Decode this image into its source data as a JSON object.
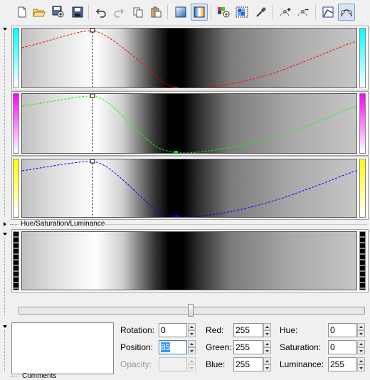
{
  "toolbar": {
    "buttons": [
      {
        "name": "new-icon"
      },
      {
        "name": "open-folder-icon"
      },
      {
        "name": "save-as-icon"
      },
      {
        "name": "save-icon"
      },
      {
        "name": "undo-icon"
      },
      {
        "name": "redo-icon"
      },
      {
        "name": "copy-icon"
      },
      {
        "name": "paste-icon"
      },
      {
        "name": "gradient-view-icon"
      },
      {
        "name": "channel-view-icon"
      },
      {
        "name": "add-color-icon"
      },
      {
        "name": "select-color-icon"
      },
      {
        "name": "eyedropper-icon"
      },
      {
        "name": "add-node-icon"
      },
      {
        "name": "remove-node-icon"
      },
      {
        "name": "linear-interpolation-icon"
      },
      {
        "name": "smooth-interpolation-icon"
      }
    ]
  },
  "channels": [
    {
      "name": "red",
      "color": "#ff0000",
      "bar_gradient": [
        "#00ffff",
        "#ffffff"
      ]
    },
    {
      "name": "green",
      "color": "#00ff00",
      "bar_gradient": [
        "#ff00ff",
        "#ffffff"
      ]
    },
    {
      "name": "blue",
      "color": "#0000ff",
      "bar_gradient": [
        "#ffff00",
        "#ffffff"
      ]
    }
  ],
  "hsl_section": {
    "title": "Hue/Saturation/Luminance"
  },
  "slider": {
    "position_fraction": 0.5
  },
  "fields": {
    "rotation": {
      "label": "Rotation:",
      "value": "0"
    },
    "position": {
      "label": "Position:",
      "value": "85"
    },
    "opacity": {
      "label": "Opacity:",
      "value": ""
    },
    "red": {
      "label": "Red:",
      "value": "255"
    },
    "green": {
      "label": "Green:",
      "value": "255"
    },
    "blue": {
      "label": "Blue:",
      "value": "255"
    },
    "hue": {
      "label": "Hue:",
      "value": "0"
    },
    "saturation": {
      "label": "Saturation:",
      "value": "0"
    },
    "luminance": {
      "label": "Luminance:",
      "value": "255"
    }
  },
  "comments_section": {
    "title": "Comments"
  }
}
